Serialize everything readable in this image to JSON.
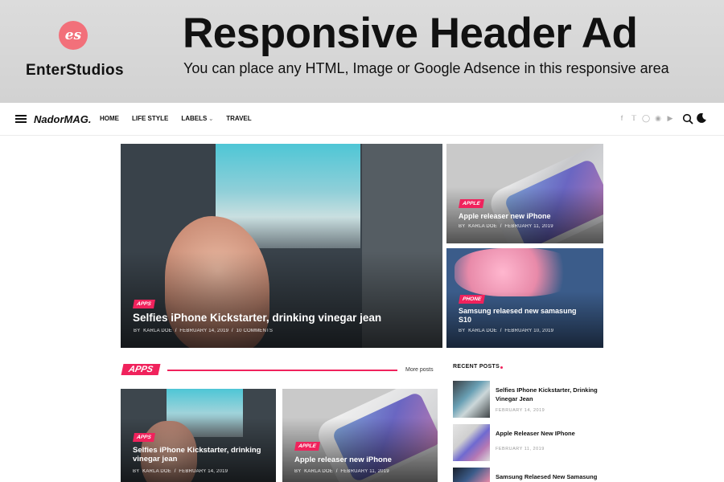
{
  "ad": {
    "logo_text": "es",
    "brand": "EnterStudios",
    "title": "Responsive Header Ad",
    "subtitle": "You can place any  HTML,  Image or Google Adsence in this responsive area"
  },
  "nav": {
    "brand": "NadorMAG.",
    "items": [
      {
        "label": "HOME"
      },
      {
        "label": "LIFE STYLE"
      },
      {
        "label": "LABELS"
      },
      {
        "label": "TRAVEL"
      }
    ],
    "social_icons": [
      "facebook-icon",
      "twitter-icon",
      "instagram-icon",
      "github-icon",
      "youtube-icon"
    ]
  },
  "featured": {
    "main": {
      "tag": "APPS",
      "title": "Selfies iPhone Kickstarter, drinking vinegar jean",
      "by": "BY",
      "author": "KARLA DOE",
      "date": "FEBRUARY 14, 2019",
      "comments": "10 COMMENTS"
    },
    "side": [
      {
        "tag": "APPLE",
        "title": "Apple releaser new iPhone",
        "by": "BY",
        "author": "KARLA DOE",
        "date": "FEBRUARY 11, 2019"
      },
      {
        "tag": "PHONE",
        "title": "Samsung relaesed new samasung S10",
        "by": "BY",
        "author": "KARLA DOE",
        "date": "FEBRUARY 10, 2019"
      }
    ]
  },
  "apps_section": {
    "label": "APPS",
    "more": "More posts",
    "posts": [
      {
        "tag": "APPS",
        "title": "Selfies iPhone Kickstarter, drinking vinegar jean",
        "by": "BY",
        "author": "KARLA DOE",
        "date": "FEBRUARY 14, 2019"
      },
      {
        "tag": "APPLE",
        "title": "Apple releaser new iPhone",
        "by": "BY",
        "author": "KARLA DOE",
        "date": "FEBRUARY 11, 2019"
      }
    ]
  },
  "recent": {
    "heading": "RECENT POSTS",
    "posts": [
      {
        "title": "Selfies IPhone Kickstarter, Drinking Vinegar Jean",
        "date": "FEBRUARY 14, 2019"
      },
      {
        "title": "Apple Releaser New IPhone",
        "date": "FEBRUARY 11, 2019"
      },
      {
        "title": "Samsung Relaesed New Samasung",
        "date": ""
      }
    ]
  },
  "colors": {
    "accent": "#f0225c",
    "logo": "#f2707a"
  }
}
